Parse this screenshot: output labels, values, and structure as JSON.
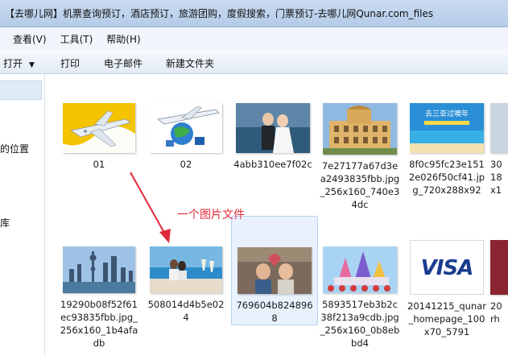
{
  "window": {
    "title": "【去哪儿网】机票查询预订，酒店预订，旅游团购，度假搜索，门票预订-去哪儿网Qunar.com_files"
  },
  "menu": {
    "view": "查看(V)",
    "tools": "工具(T)",
    "help": "帮助(H)"
  },
  "toolbar": {
    "open": "打开",
    "print": "打印",
    "email": "电子邮件",
    "new_folder": "新建文件夹"
  },
  "nav": {
    "location_fragment": "的位置",
    "library_fragment": "库"
  },
  "files": [
    {
      "name": "01"
    },
    {
      "name": "02"
    },
    {
      "name": "4abb310ee7f02c"
    },
    {
      "name": "7e27177a67d3ea2493835fbb.jpg_256x160_740e34dc"
    },
    {
      "name": "8f0c95fc23e1512e026f50cf41.jpg_720x288x92"
    },
    {
      "name": "30\n18\nx1"
    },
    {
      "name": "19290b08f52f61ec93835fbb.jpg_256x160_1b4afadb"
    },
    {
      "name": "508014d4b5e024"
    },
    {
      "name": "769604b8248968"
    },
    {
      "name": "5893517eb3b2c38f213a9cdb.jpg_256x160_0b8ebbd4"
    },
    {
      "name": "20141215_qunar_homepage_100x70_5791"
    },
    {
      "name": "20\nrh"
    }
  ],
  "thumb_text": {
    "banner": "去三亚过噢年",
    "visa": "VISA"
  },
  "annotation": {
    "text": "一个图片文件",
    "color": "#e0283a"
  },
  "colors": {
    "selection_bg": "#e8f1fc",
    "selection_border": "#b9d3f0"
  }
}
